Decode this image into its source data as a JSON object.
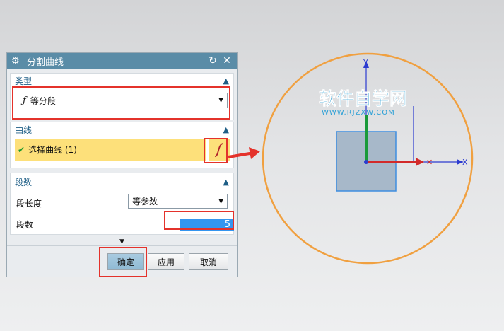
{
  "dialog": {
    "title": "分割曲线",
    "type_section": {
      "label": "类型",
      "selected": "等分段"
    },
    "curve_section": {
      "label": "曲线",
      "select_label": "选择曲线 (1)"
    },
    "segments_section": {
      "label": "段数",
      "length_label": "段长度",
      "length_value": "等参数",
      "count_label": "段数",
      "count_value": "5"
    },
    "buttons": {
      "ok": "确定",
      "apply": "应用",
      "cancel": "取消"
    }
  },
  "watermark": {
    "title": "软件自学网",
    "url": "WWW.RJZXW.COM"
  },
  "axes": {
    "y": "Y",
    "x": "X"
  },
  "colors": {
    "titlebar": "#5a8ca7",
    "section_label": "#1e5e86",
    "highlight": "#fde07a",
    "annotation": "#e4322b",
    "circle": "#f0a040",
    "watermark": "#2a9fd6"
  }
}
